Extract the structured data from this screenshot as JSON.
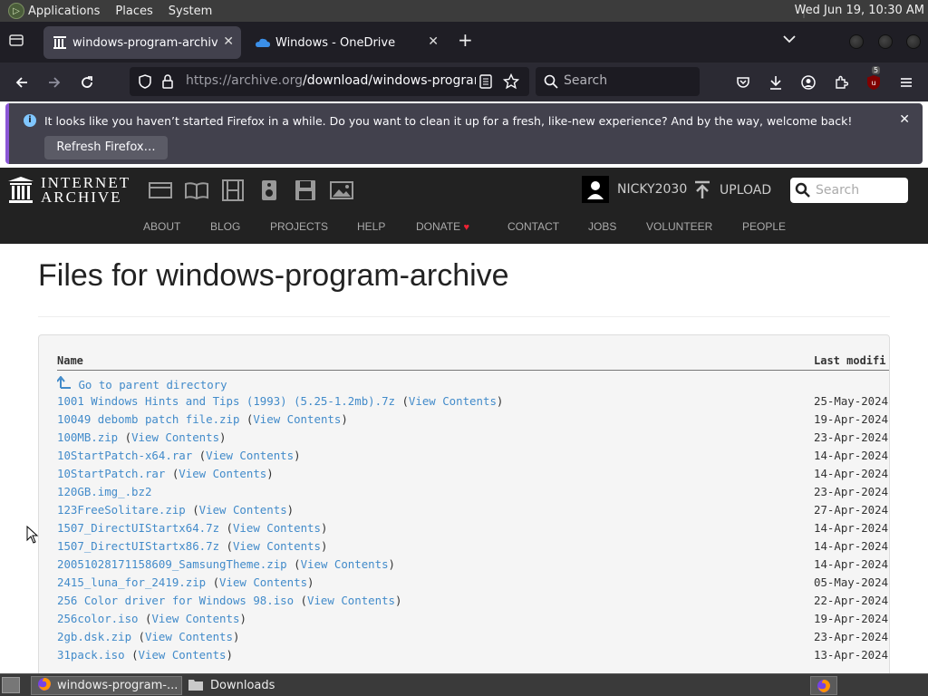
{
  "top_panel": {
    "menus": [
      "Applications",
      "Places",
      "System"
    ],
    "clock": "Wed Jun 19, 10:30 AM"
  },
  "browser": {
    "tabs": [
      {
        "label": "windows-program-archive",
        "icon": "archive-icon"
      },
      {
        "label": "Windows - OneDrive",
        "icon": "onedrive-icon"
      }
    ],
    "url_domain": "https://archive.org",
    "url_path": "/download/windows-program-a",
    "search_placeholder": "Search",
    "extension_badge": "5",
    "notification": {
      "message": "It looks like you haven’t started Firefox in a while. Do you want to clean it up for a fresh, like-new experience? And by the way, welcome back!",
      "button": "Refresh Firefox…"
    }
  },
  "ia": {
    "logo_line1": "INTERNET",
    "logo_line2": "ARCHIVE",
    "username": "NICKY2030",
    "upload": "UPLOAD",
    "search_placeholder": "Search",
    "links": [
      "ABOUT",
      "BLOG",
      "PROJECTS",
      "HELP",
      "DONATE",
      "CONTACT",
      "JOBS",
      "VOLUNTEER",
      "PEOPLE"
    ]
  },
  "page": {
    "heading": "Files for windows-program-archive",
    "col_name": "Name",
    "col_modified": "Last modifi",
    "parent_link": "Go to parent directory",
    "view_contents": "View Contents",
    "files": [
      {
        "name": "1001 Windows Hints and Tips (1993) (5.25-1.2mb).7z",
        "date": "25-May-2024",
        "contents": true
      },
      {
        "name": "10049 debomb patch file.zip",
        "date": "19-Apr-2024",
        "contents": true
      },
      {
        "name": "100MB.zip",
        "date": "23-Apr-2024",
        "contents": true
      },
      {
        "name": "10StartPatch-x64.rar",
        "date": "14-Apr-2024",
        "contents": true
      },
      {
        "name": "10StartPatch.rar",
        "date": "14-Apr-2024",
        "contents": true
      },
      {
        "name": "120GB.img_.bz2",
        "date": "23-Apr-2024",
        "contents": false
      },
      {
        "name": "123FreeSolitare.zip",
        "date": "27-Apr-2024",
        "contents": true
      },
      {
        "name": "1507_DirectUIStartx64.7z",
        "date": "14-Apr-2024",
        "contents": true
      },
      {
        "name": "1507_DirectUIStartx86.7z",
        "date": "14-Apr-2024",
        "contents": true
      },
      {
        "name": "20051028171158609_SamsungTheme.zip",
        "date": "14-Apr-2024",
        "contents": true
      },
      {
        "name": "2415_luna_for_2419.zip",
        "date": "05-May-2024",
        "contents": true
      },
      {
        "name": "256 Color driver for Windows 98.iso",
        "date": "22-Apr-2024",
        "contents": true
      },
      {
        "name": "256color.iso",
        "date": "19-Apr-2024",
        "contents": true
      },
      {
        "name": "2gb.dsk.zip",
        "date": "23-Apr-2024",
        "contents": true
      },
      {
        "name": "31pack.iso",
        "date": "13-Apr-2024",
        "contents": true
      }
    ]
  },
  "taskbar": {
    "items": [
      "windows-program-...",
      "Downloads"
    ]
  }
}
